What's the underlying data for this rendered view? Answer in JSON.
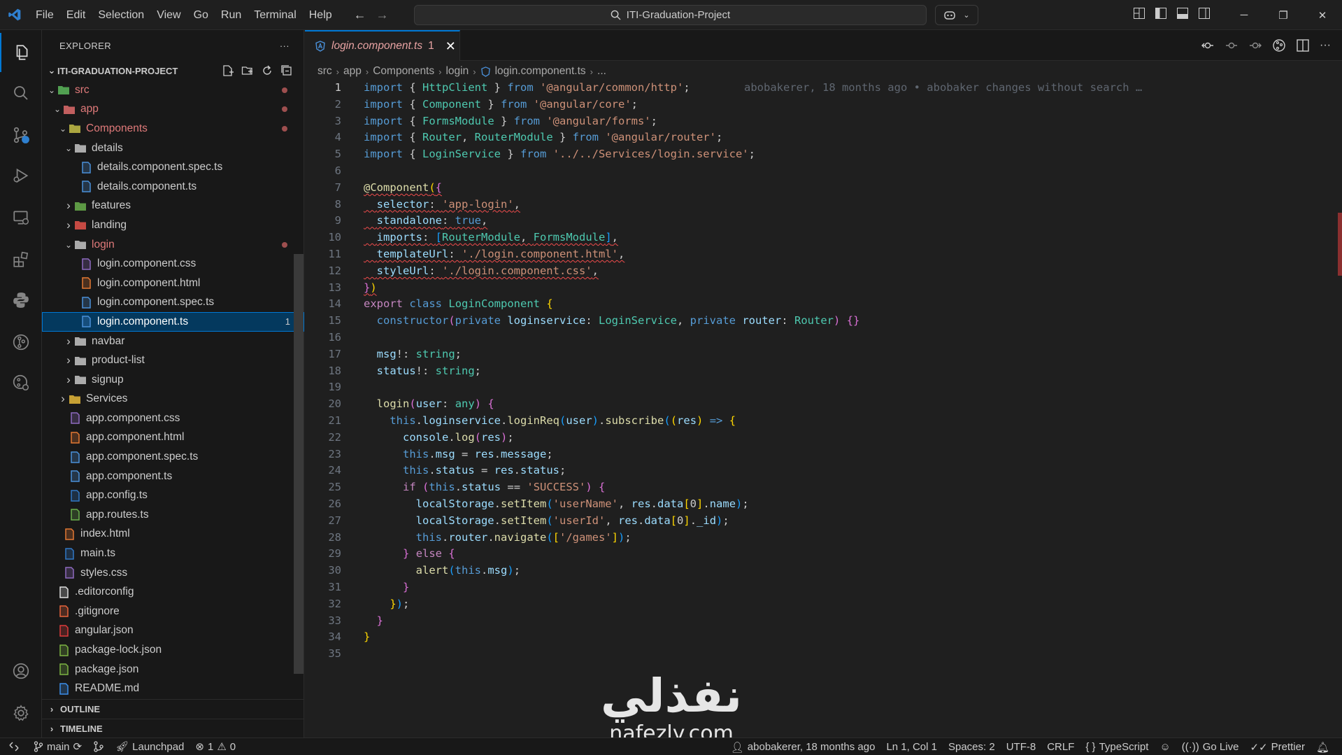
{
  "titlebar": {
    "menu": [
      "File",
      "Edit",
      "Selection",
      "View",
      "Go",
      "Run",
      "Terminal",
      "Help"
    ],
    "search_text": "ITI-Graduation-Project"
  },
  "sidebar": {
    "title": "EXPLORER",
    "more": "···",
    "project": "ITI-GRADUATION-PROJECT",
    "tree": [
      {
        "label": "src",
        "depth": 1,
        "kind": "folder-open",
        "icon": "src-folder-icon",
        "color": "#5cb85c",
        "dot": true
      },
      {
        "label": "app",
        "depth": 2,
        "kind": "folder-open",
        "icon": "app-folder-icon",
        "color": "#e06c6c",
        "dot": true
      },
      {
        "label": "Components",
        "depth": 3,
        "kind": "folder-open",
        "icon": "components-folder-icon",
        "color": "#c5c048",
        "dot": true
      },
      {
        "label": "details",
        "depth": 4,
        "kind": "folder-open",
        "icon": "folder-icon",
        "color": "#c5c5c5"
      },
      {
        "label": "details.component.spec.ts",
        "depth": 5,
        "kind": "file",
        "icon": "test-flask-icon",
        "color": "#4a90d9"
      },
      {
        "label": "details.component.ts",
        "depth": 5,
        "kind": "file",
        "icon": "angular-ts-icon",
        "color": "#4a90d9"
      },
      {
        "label": "features",
        "depth": 4,
        "kind": "folder-closed",
        "icon": "features-folder-icon",
        "color": "#6ab04c"
      },
      {
        "label": "landing",
        "depth": 4,
        "kind": "folder-closed",
        "icon": "landing-folder-icon",
        "color": "#e5534b"
      },
      {
        "label": "login",
        "depth": 4,
        "kind": "folder-open",
        "icon": "folder-icon",
        "color": "#c5c5c5",
        "dot": true
      },
      {
        "label": "login.component.css",
        "depth": 5,
        "kind": "file",
        "icon": "css-icon",
        "color": "#8e6ac0"
      },
      {
        "label": "login.component.html",
        "depth": 5,
        "kind": "file",
        "icon": "html-icon",
        "color": "#e37933"
      },
      {
        "label": "login.component.spec.ts",
        "depth": 5,
        "kind": "file",
        "icon": "test-flask-icon",
        "color": "#4a90d9"
      },
      {
        "label": "login.component.ts",
        "depth": 5,
        "kind": "file",
        "icon": "angular-ts-icon",
        "color": "#4a90d9",
        "selected": true,
        "badge": "1"
      },
      {
        "label": "navbar",
        "depth": 4,
        "kind": "folder-closed",
        "icon": "folder-icon",
        "color": "#c5c5c5"
      },
      {
        "label": "product-list",
        "depth": 4,
        "kind": "folder-closed",
        "icon": "folder-icon",
        "color": "#c5c5c5"
      },
      {
        "label": "signup",
        "depth": 4,
        "kind": "folder-closed",
        "icon": "folder-icon",
        "color": "#c5c5c5"
      },
      {
        "label": "Services",
        "depth": 3,
        "kind": "folder-closed",
        "icon": "services-folder-icon",
        "color": "#e5b83a"
      },
      {
        "label": "app.component.css",
        "depth": 3,
        "kind": "file",
        "icon": "css-icon",
        "color": "#8e6ac0"
      },
      {
        "label": "app.component.html",
        "depth": 3,
        "kind": "file",
        "icon": "html-icon",
        "color": "#e37933"
      },
      {
        "label": "app.component.spec.ts",
        "depth": 3,
        "kind": "file",
        "icon": "test-flask-icon",
        "color": "#4a90d9"
      },
      {
        "label": "app.component.ts",
        "depth": 3,
        "kind": "file",
        "icon": "angular-ts-icon",
        "color": "#4a90d9"
      },
      {
        "label": "app.config.ts",
        "depth": 3,
        "kind": "file",
        "icon": "ts-config-icon",
        "color": "#3178c6"
      },
      {
        "label": "app.routes.ts",
        "depth": 3,
        "kind": "file",
        "icon": "routes-icon",
        "color": "#6ab04c"
      },
      {
        "label": "index.html",
        "depth": 2,
        "kind": "file",
        "icon": "html-icon",
        "color": "#e37933"
      },
      {
        "label": "main.ts",
        "depth": 2,
        "kind": "file",
        "icon": "ts-file-icon",
        "color": "#3178c6"
      },
      {
        "label": "styles.css",
        "depth": 2,
        "kind": "file",
        "icon": "css-icon",
        "color": "#8e6ac0"
      },
      {
        "label": ".editorconfig",
        "depth": 1,
        "kind": "file",
        "icon": "editorconfig-icon",
        "color": "#e0e0e0"
      },
      {
        "label": ".gitignore",
        "depth": 1,
        "kind": "file",
        "icon": "git-icon",
        "color": "#e8643c"
      },
      {
        "label": "angular.json",
        "depth": 1,
        "kind": "file",
        "icon": "angular-icon",
        "color": "#dd3b3b"
      },
      {
        "label": "package-lock.json",
        "depth": 1,
        "kind": "file",
        "icon": "npm-package-icon",
        "color": "#7cb342"
      },
      {
        "label": "package.json",
        "depth": 1,
        "kind": "file",
        "icon": "npm-package-icon",
        "color": "#7cb342"
      },
      {
        "label": "README.md",
        "depth": 1,
        "kind": "file",
        "icon": "info-icon",
        "color": "#3b8eea"
      }
    ],
    "outline": "OUTLINE",
    "timeline": "TIMELINE"
  },
  "editor": {
    "tab": {
      "label": "login.component.ts",
      "count": "1",
      "close": "✕"
    },
    "breadcrumb": [
      "src",
      "app",
      "Components",
      "login",
      "login.component.ts",
      "..."
    ],
    "blame": "abobakerer, 18 months ago • abobaker changes without search …",
    "lines": [
      [
        [
          "k",
          "import"
        ],
        [
          "p",
          " { "
        ],
        [
          "t",
          "HttpClient"
        ],
        [
          "p",
          " } "
        ],
        [
          "k",
          "from"
        ],
        [
          "p",
          " "
        ],
        [
          "s",
          "'@angular/common/http'"
        ],
        [
          "p",
          ";"
        ]
      ],
      [
        [
          "k",
          "import"
        ],
        [
          "p",
          " { "
        ],
        [
          "t",
          "Component"
        ],
        [
          "p",
          " } "
        ],
        [
          "k",
          "from"
        ],
        [
          "p",
          " "
        ],
        [
          "s",
          "'@angular/core'"
        ],
        [
          "p",
          ";"
        ]
      ],
      [
        [
          "k",
          "import"
        ],
        [
          "p",
          " { "
        ],
        [
          "t",
          "FormsModule"
        ],
        [
          "p",
          " } "
        ],
        [
          "k",
          "from"
        ],
        [
          "p",
          " "
        ],
        [
          "s",
          "'@angular/forms'"
        ],
        [
          "p",
          ";"
        ]
      ],
      [
        [
          "k",
          "import"
        ],
        [
          "p",
          " { "
        ],
        [
          "t",
          "Router"
        ],
        [
          "p",
          ", "
        ],
        [
          "t",
          "RouterModule"
        ],
        [
          "p",
          " } "
        ],
        [
          "k",
          "from"
        ],
        [
          "p",
          " "
        ],
        [
          "s",
          "'@angular/router'"
        ],
        [
          "p",
          ";"
        ]
      ],
      [
        [
          "k",
          "import"
        ],
        [
          "p",
          " { "
        ],
        [
          "t",
          "LoginService"
        ],
        [
          "p",
          " } "
        ],
        [
          "k",
          "from"
        ],
        [
          "p",
          " "
        ],
        [
          "s",
          "'../../Services/login.service'"
        ],
        [
          "p",
          ";"
        ]
      ],
      [],
      [
        [
          "dec",
          "@Component"
        ],
        [
          "b1",
          "("
        ],
        [
          "b2",
          "{"
        ]
      ],
      [
        [
          "p",
          "  "
        ],
        [
          "v",
          "selector"
        ],
        [
          "p",
          ": "
        ],
        [
          "s",
          "'app-login'"
        ],
        [
          "p",
          ","
        ]
      ],
      [
        [
          "p",
          "  "
        ],
        [
          "v",
          "standalone"
        ],
        [
          "p",
          ": "
        ],
        [
          "k",
          "true"
        ],
        [
          "p",
          ","
        ]
      ],
      [
        [
          "p",
          "  "
        ],
        [
          "v",
          "imports"
        ],
        [
          "p",
          ": "
        ],
        [
          "b3",
          "["
        ],
        [
          "t",
          "RouterModule"
        ],
        [
          "p",
          ", "
        ],
        [
          "t",
          "FormsModule"
        ],
        [
          "b3",
          "]"
        ],
        [
          "p",
          ","
        ]
      ],
      [
        [
          "p",
          "  "
        ],
        [
          "v",
          "templateUrl"
        ],
        [
          "p",
          ": "
        ],
        [
          "s",
          "'./login.component.html'"
        ],
        [
          "p",
          ","
        ]
      ],
      [
        [
          "p",
          "  "
        ],
        [
          "v",
          "styleUrl"
        ],
        [
          "p",
          ": "
        ],
        [
          "s",
          "'./login.component.css'"
        ],
        [
          "p",
          ","
        ]
      ],
      [
        [
          "b2",
          "}"
        ],
        [
          "b1",
          ")"
        ]
      ],
      [
        [
          "ck",
          "export"
        ],
        [
          "p",
          " "
        ],
        [
          "k",
          "class"
        ],
        [
          "p",
          " "
        ],
        [
          "t",
          "LoginComponent"
        ],
        [
          "p",
          " "
        ],
        [
          "b1",
          "{"
        ]
      ],
      [
        [
          "p",
          "  "
        ],
        [
          "k",
          "constructor"
        ],
        [
          "b2",
          "("
        ],
        [
          "k",
          "private"
        ],
        [
          "p",
          " "
        ],
        [
          "v",
          "loginservice"
        ],
        [
          "p",
          ": "
        ],
        [
          "t",
          "LoginService"
        ],
        [
          "p",
          ", "
        ],
        [
          "k",
          "private"
        ],
        [
          "p",
          " "
        ],
        [
          "v",
          "router"
        ],
        [
          "p",
          ": "
        ],
        [
          "t",
          "Router"
        ],
        [
          "b2",
          ")"
        ],
        [
          "p",
          " "
        ],
        [
          "b2",
          "{}"
        ]
      ],
      [],
      [
        [
          "p",
          "  "
        ],
        [
          "v",
          "msg"
        ],
        [
          "p",
          "!: "
        ],
        [
          "t",
          "string"
        ],
        [
          "p",
          ";"
        ]
      ],
      [
        [
          "p",
          "  "
        ],
        [
          "v",
          "status"
        ],
        [
          "p",
          "!: "
        ],
        [
          "t",
          "string"
        ],
        [
          "p",
          ";"
        ]
      ],
      [],
      [
        [
          "p",
          "  "
        ],
        [
          "f",
          "login"
        ],
        [
          "b2",
          "("
        ],
        [
          "v",
          "user"
        ],
        [
          "p",
          ": "
        ],
        [
          "t",
          "any"
        ],
        [
          "b2",
          ")"
        ],
        [
          "p",
          " "
        ],
        [
          "b2",
          "{"
        ]
      ],
      [
        [
          "p",
          "    "
        ],
        [
          "k",
          "this"
        ],
        [
          "p",
          "."
        ],
        [
          "v",
          "loginservice"
        ],
        [
          "p",
          "."
        ],
        [
          "f",
          "loginReq"
        ],
        [
          "b3",
          "("
        ],
        [
          "v",
          "user"
        ],
        [
          "b3",
          ")"
        ],
        [
          "p",
          "."
        ],
        [
          "f",
          "subscribe"
        ],
        [
          "b3",
          "("
        ],
        [
          "b1",
          "("
        ],
        [
          "v",
          "res"
        ],
        [
          "b1",
          ")"
        ],
        [
          "p",
          " "
        ],
        [
          "k",
          "=>"
        ],
        [
          "p",
          " "
        ],
        [
          "b1",
          "{"
        ]
      ],
      [
        [
          "p",
          "      "
        ],
        [
          "v",
          "console"
        ],
        [
          "p",
          "."
        ],
        [
          "f",
          "log"
        ],
        [
          "b2",
          "("
        ],
        [
          "v",
          "res"
        ],
        [
          "b2",
          ")"
        ],
        [
          "p",
          ";"
        ]
      ],
      [
        [
          "p",
          "      "
        ],
        [
          "k",
          "this"
        ],
        [
          "p",
          "."
        ],
        [
          "v",
          "msg"
        ],
        [
          "p",
          " = "
        ],
        [
          "v",
          "res"
        ],
        [
          "p",
          "."
        ],
        [
          "v",
          "message"
        ],
        [
          "p",
          ";"
        ]
      ],
      [
        [
          "p",
          "      "
        ],
        [
          "k",
          "this"
        ],
        [
          "p",
          "."
        ],
        [
          "v",
          "status"
        ],
        [
          "p",
          " = "
        ],
        [
          "v",
          "res"
        ],
        [
          "p",
          "."
        ],
        [
          "v",
          "status"
        ],
        [
          "p",
          ";"
        ]
      ],
      [
        [
          "p",
          "      "
        ],
        [
          "ck",
          "if"
        ],
        [
          "p",
          " "
        ],
        [
          "b2",
          "("
        ],
        [
          "k",
          "this"
        ],
        [
          "p",
          "."
        ],
        [
          "v",
          "status"
        ],
        [
          "p",
          " == "
        ],
        [
          "s",
          "'SUCCESS'"
        ],
        [
          "b2",
          ")"
        ],
        [
          "p",
          " "
        ],
        [
          "b2",
          "{"
        ]
      ],
      [
        [
          "p",
          "        "
        ],
        [
          "v",
          "localStorage"
        ],
        [
          "p",
          "."
        ],
        [
          "f",
          "setItem"
        ],
        [
          "b3",
          "("
        ],
        [
          "s",
          "'userName'"
        ],
        [
          "p",
          ", "
        ],
        [
          "v",
          "res"
        ],
        [
          "p",
          "."
        ],
        [
          "v",
          "data"
        ],
        [
          "b1",
          "["
        ],
        [
          "p",
          "0"
        ],
        [
          "b1",
          "]"
        ],
        [
          "p",
          "."
        ],
        [
          "v",
          "name"
        ],
        [
          "b3",
          ")"
        ],
        [
          "p",
          ";"
        ]
      ],
      [
        [
          "p",
          "        "
        ],
        [
          "v",
          "localStorage"
        ],
        [
          "p",
          "."
        ],
        [
          "f",
          "setItem"
        ],
        [
          "b3",
          "("
        ],
        [
          "s",
          "'userId'"
        ],
        [
          "p",
          ", "
        ],
        [
          "v",
          "res"
        ],
        [
          "p",
          "."
        ],
        [
          "v",
          "data"
        ],
        [
          "b1",
          "["
        ],
        [
          "p",
          "0"
        ],
        [
          "b1",
          "]"
        ],
        [
          "p",
          "."
        ],
        [
          "v",
          "_id"
        ],
        [
          "b3",
          ")"
        ],
        [
          "p",
          ";"
        ]
      ],
      [
        [
          "p",
          "        "
        ],
        [
          "k",
          "this"
        ],
        [
          "p",
          "."
        ],
        [
          "v",
          "router"
        ],
        [
          "p",
          "."
        ],
        [
          "f",
          "navigate"
        ],
        [
          "b3",
          "("
        ],
        [
          "b1",
          "["
        ],
        [
          "s",
          "'/games'"
        ],
        [
          "b1",
          "]"
        ],
        [
          "b3",
          ")"
        ],
        [
          "p",
          ";"
        ]
      ],
      [
        [
          "p",
          "      "
        ],
        [
          "b2",
          "}"
        ],
        [
          "p",
          " "
        ],
        [
          "ck",
          "else"
        ],
        [
          "p",
          " "
        ],
        [
          "b2",
          "{"
        ]
      ],
      [
        [
          "p",
          "        "
        ],
        [
          "f",
          "alert"
        ],
        [
          "b3",
          "("
        ],
        [
          "k",
          "this"
        ],
        [
          "p",
          "."
        ],
        [
          "v",
          "msg"
        ],
        [
          "b3",
          ")"
        ],
        [
          "p",
          ";"
        ]
      ],
      [
        [
          "p",
          "      "
        ],
        [
          "b2",
          "}"
        ]
      ],
      [
        [
          "p",
          "    "
        ],
        [
          "b1",
          "}"
        ],
        [
          "b3",
          ")"
        ],
        [
          "p",
          ";"
        ]
      ],
      [
        [
          "p",
          "  "
        ],
        [
          "b2",
          "}"
        ]
      ],
      [
        [
          "b1",
          "}"
        ]
      ],
      []
    ]
  },
  "statusbar": {
    "branch": "main",
    "launchpad": "Launchpad",
    "errors": "1",
    "warnings": "0",
    "blame": "abobakerer, 18 months ago",
    "position": "Ln 1, Col 1",
    "spaces": "Spaces: 2",
    "encoding": "UTF-8",
    "eol": "CRLF",
    "language": "TypeScript",
    "golive": "Go Live",
    "prettier": "Prettier"
  },
  "watermark": {
    "arabic": "نفذلي",
    "latin": "nafezly.com"
  },
  "colors": {
    "accent": "#0078d4",
    "selection": "#04395e",
    "error": "#f14c4c"
  }
}
